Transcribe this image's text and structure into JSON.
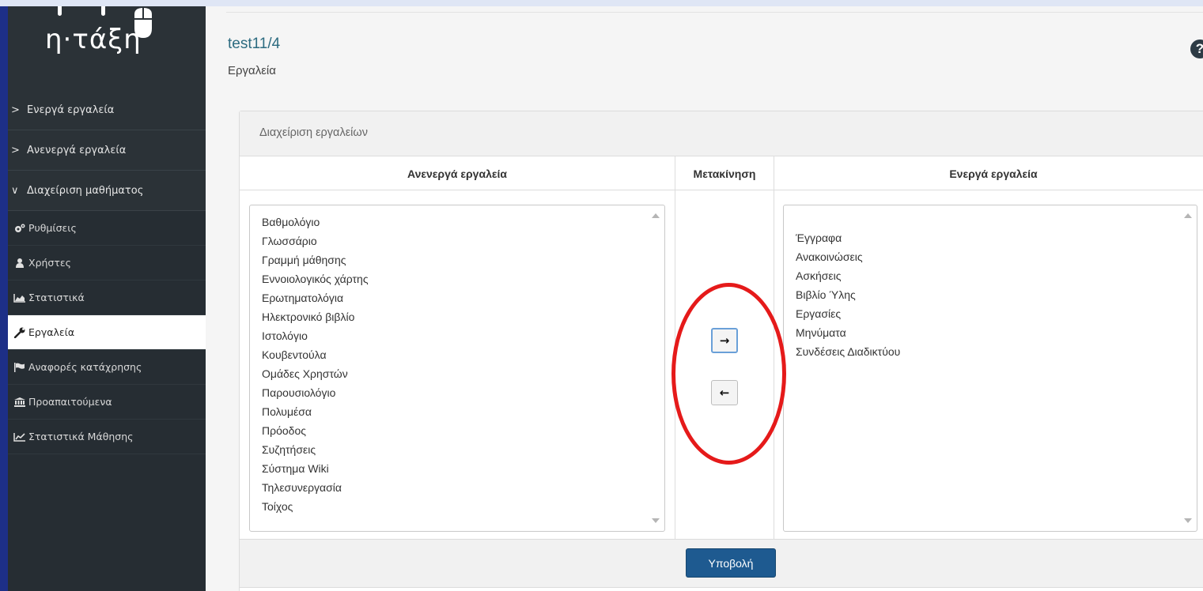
{
  "logo": {
    "text": "η·τάξη"
  },
  "sidebar": {
    "groups": [
      {
        "label": "Ενεργά εργαλεία",
        "chevron": ">"
      },
      {
        "label": "Ανενεργά εργαλεία",
        "chevron": ">"
      },
      {
        "label": "Διαχείριση μαθήματος",
        "chevron": "∨"
      }
    ],
    "items": [
      {
        "label": "Ρυθμίσεις",
        "icon": "cogs-icon"
      },
      {
        "label": "Χρήστες",
        "icon": "user-icon"
      },
      {
        "label": "Στατιστικά",
        "icon": "area-chart-icon"
      },
      {
        "label": "Εργαλεία",
        "icon": "wrench-icon",
        "active": true
      },
      {
        "label": "Αναφορές κατάχρησης",
        "icon": "flag-icon"
      },
      {
        "label": "Προαπαιτούμενα",
        "icon": "institution-icon"
      },
      {
        "label": "Στατιστικά Μάθησης",
        "icon": "line-chart-icon"
      }
    ]
  },
  "header": {
    "title": "test11/4",
    "subtitle": "Εργαλεία",
    "help": "?"
  },
  "panel": {
    "heading": "Διαχείριση εργαλείων",
    "columns": {
      "inactive": "Ανενεργά εργαλεία",
      "move": "Μετακίνηση",
      "active": "Ενεργά εργαλεία"
    },
    "inactive_tools": [
      "Βαθμολόγιο",
      "Γλωσσάριο",
      "Γραμμή μάθησης",
      "Εννοιολογικός χάρτης",
      "Ερωτηματολόγια",
      "Ηλεκτρονικό βιβλίο",
      "Ιστολόγιο",
      "Κουβεντούλα",
      "Ομάδες Χρηστών",
      "Παρουσιολόγιο",
      "Πολυμέσα",
      "Πρόοδος",
      "Συζητήσεις",
      "Σύστημα Wiki",
      "Τηλεσυνεργασία",
      "Τοίχος"
    ],
    "active_tools": [
      "Έγγραφα",
      "Ανακοινώσεις",
      "Ασκήσεις",
      "Βιβλίο Ύλης",
      "Εργασίες",
      "Μηνύματα",
      "Συνδέσεις Διαδικτύου"
    ],
    "move_right": "→",
    "move_left": "←",
    "submit": "Υποβολή"
  },
  "colors": {
    "outer_frame": "#1d2f87",
    "sidebar": "#262d33",
    "title": "#2c6b80",
    "submit": "#1e5a90",
    "annotation": "#e51a1a"
  }
}
